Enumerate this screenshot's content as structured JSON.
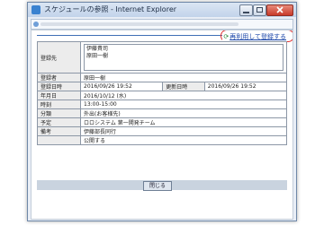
{
  "window": {
    "title": "スケジュールの参照 - Internet Explorer"
  },
  "toolbar": {
    "reuse_link": "再利用して登録する"
  },
  "form": {
    "rows": [
      {
        "label": "登録先",
        "lines": [
          "伊藤貴司",
          "原田一樹"
        ]
      },
      {
        "label": "登録者",
        "value": "原田一樹"
      },
      {
        "label": "登録日時",
        "value": "2016/09/26 19:52",
        "label2": "更新日時",
        "value2": "2016/09/26 19:52"
      },
      {
        "label": "年月日",
        "value": "2016/10/12 (水)"
      },
      {
        "label": "時刻",
        "value": "13:00-15:00"
      },
      {
        "label": "分類",
        "value": "外出(お客様先)"
      },
      {
        "label": "予定",
        "value": "ロロシステム 第一開発チーム"
      },
      {
        "label": "備考",
        "value": "伊藤部長同行"
      },
      {
        "label": "",
        "value": "公開する"
      }
    ]
  },
  "actions": {
    "close_label": "閉じる"
  }
}
